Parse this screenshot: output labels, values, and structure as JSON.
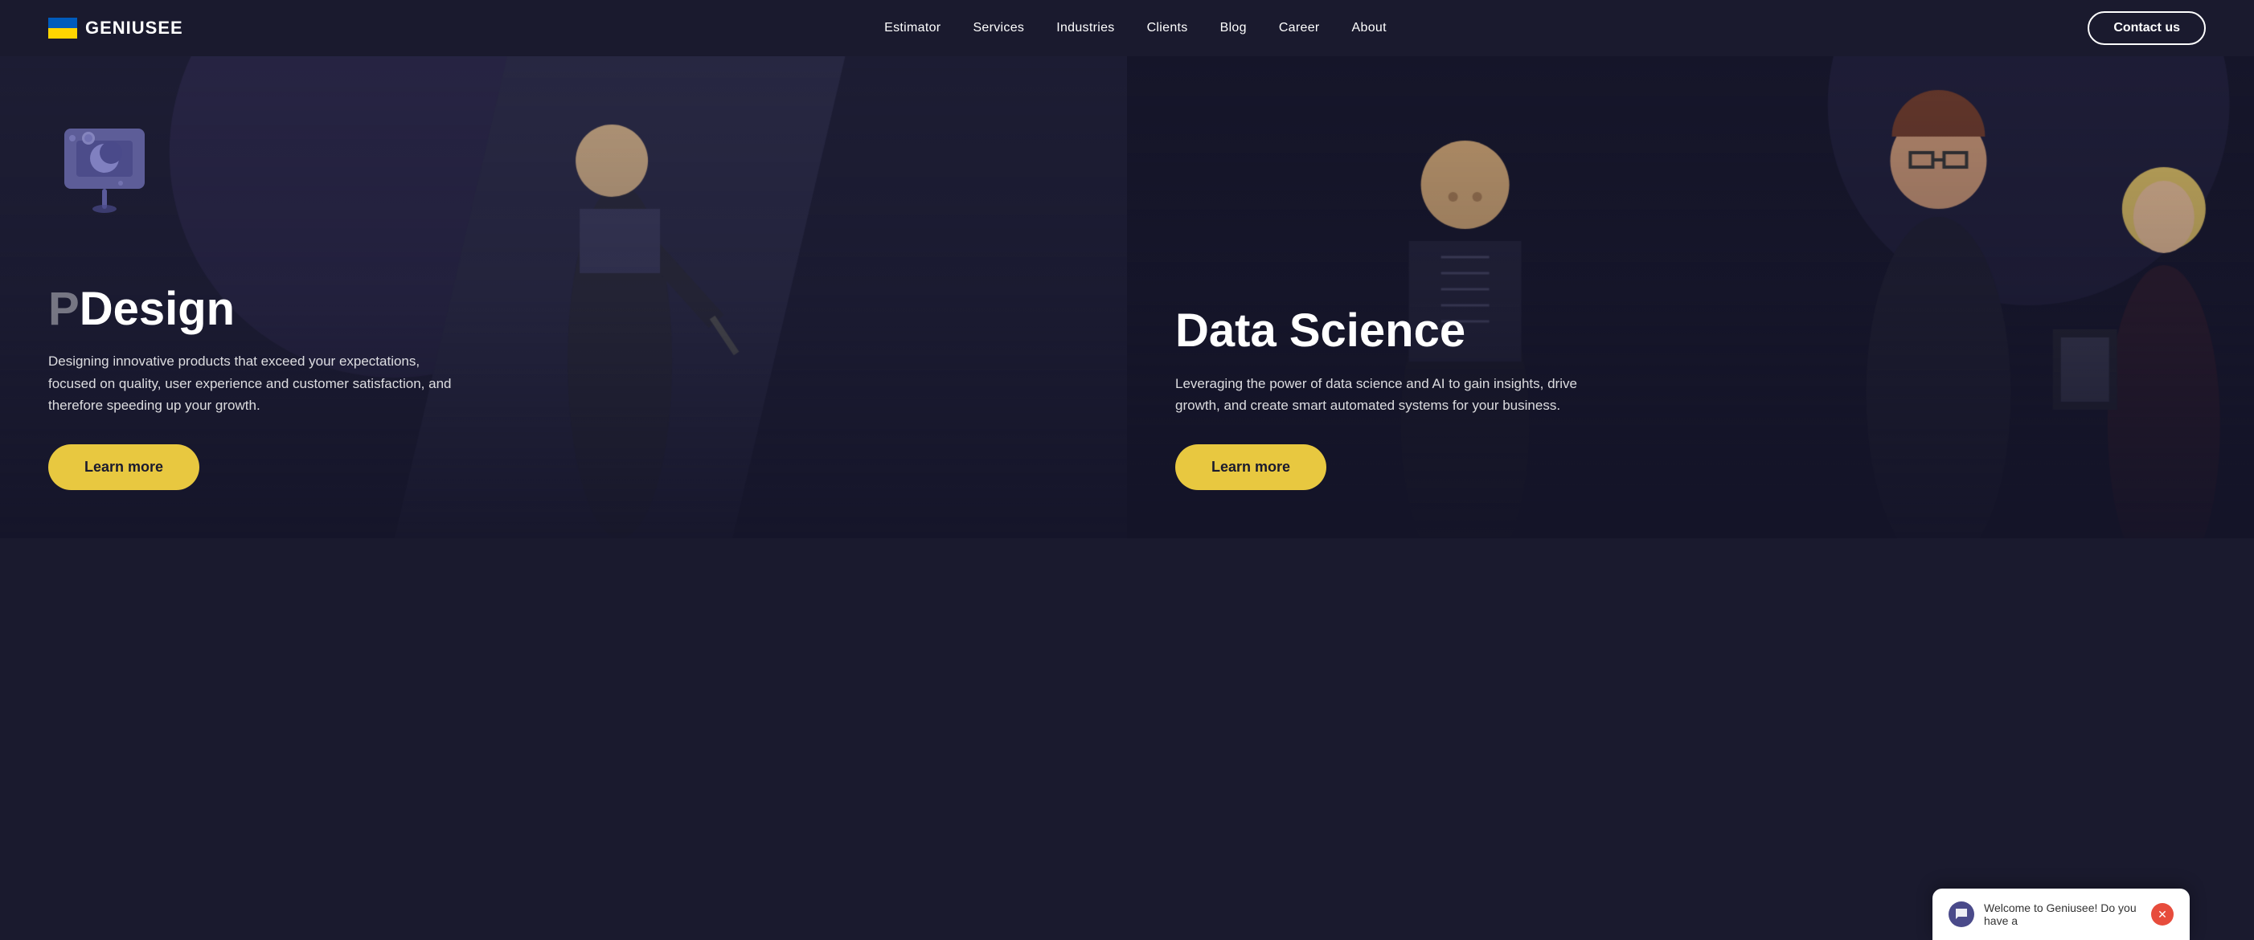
{
  "nav": {
    "logo_text": "GENIUSEE",
    "links": [
      {
        "label": "Estimator",
        "id": "estimator"
      },
      {
        "label": "Services",
        "id": "services"
      },
      {
        "label": "Industries",
        "id": "industries"
      },
      {
        "label": "Clients",
        "id": "clients"
      },
      {
        "label": "Blog",
        "id": "blog"
      },
      {
        "label": "Career",
        "id": "career"
      },
      {
        "label": "About",
        "id": "about"
      }
    ],
    "contact_button": "Contact us"
  },
  "cards": [
    {
      "id": "design",
      "title": "Design",
      "title_prefix": "P",
      "description": "Designing innovative products that exceed your expectations, focused on quality, user experience and customer satisfaction, and therefore speeding up your growth.",
      "learn_more": "Learn more",
      "icon": "design-icon"
    },
    {
      "id": "data-science",
      "title": "Data Science",
      "description": "Leveraging the power of data science and AI to gain insights, drive growth, and create smart automated systems for your business.",
      "learn_more": "Learn more",
      "icon": "data-science-icon"
    }
  ],
  "chat": {
    "text": "Welcome to Geniusee! Do you have a"
  },
  "colors": {
    "bg_dark": "#1a1a2e",
    "accent_yellow": "#e8c840",
    "nav_bg": "#1a1a2e"
  }
}
